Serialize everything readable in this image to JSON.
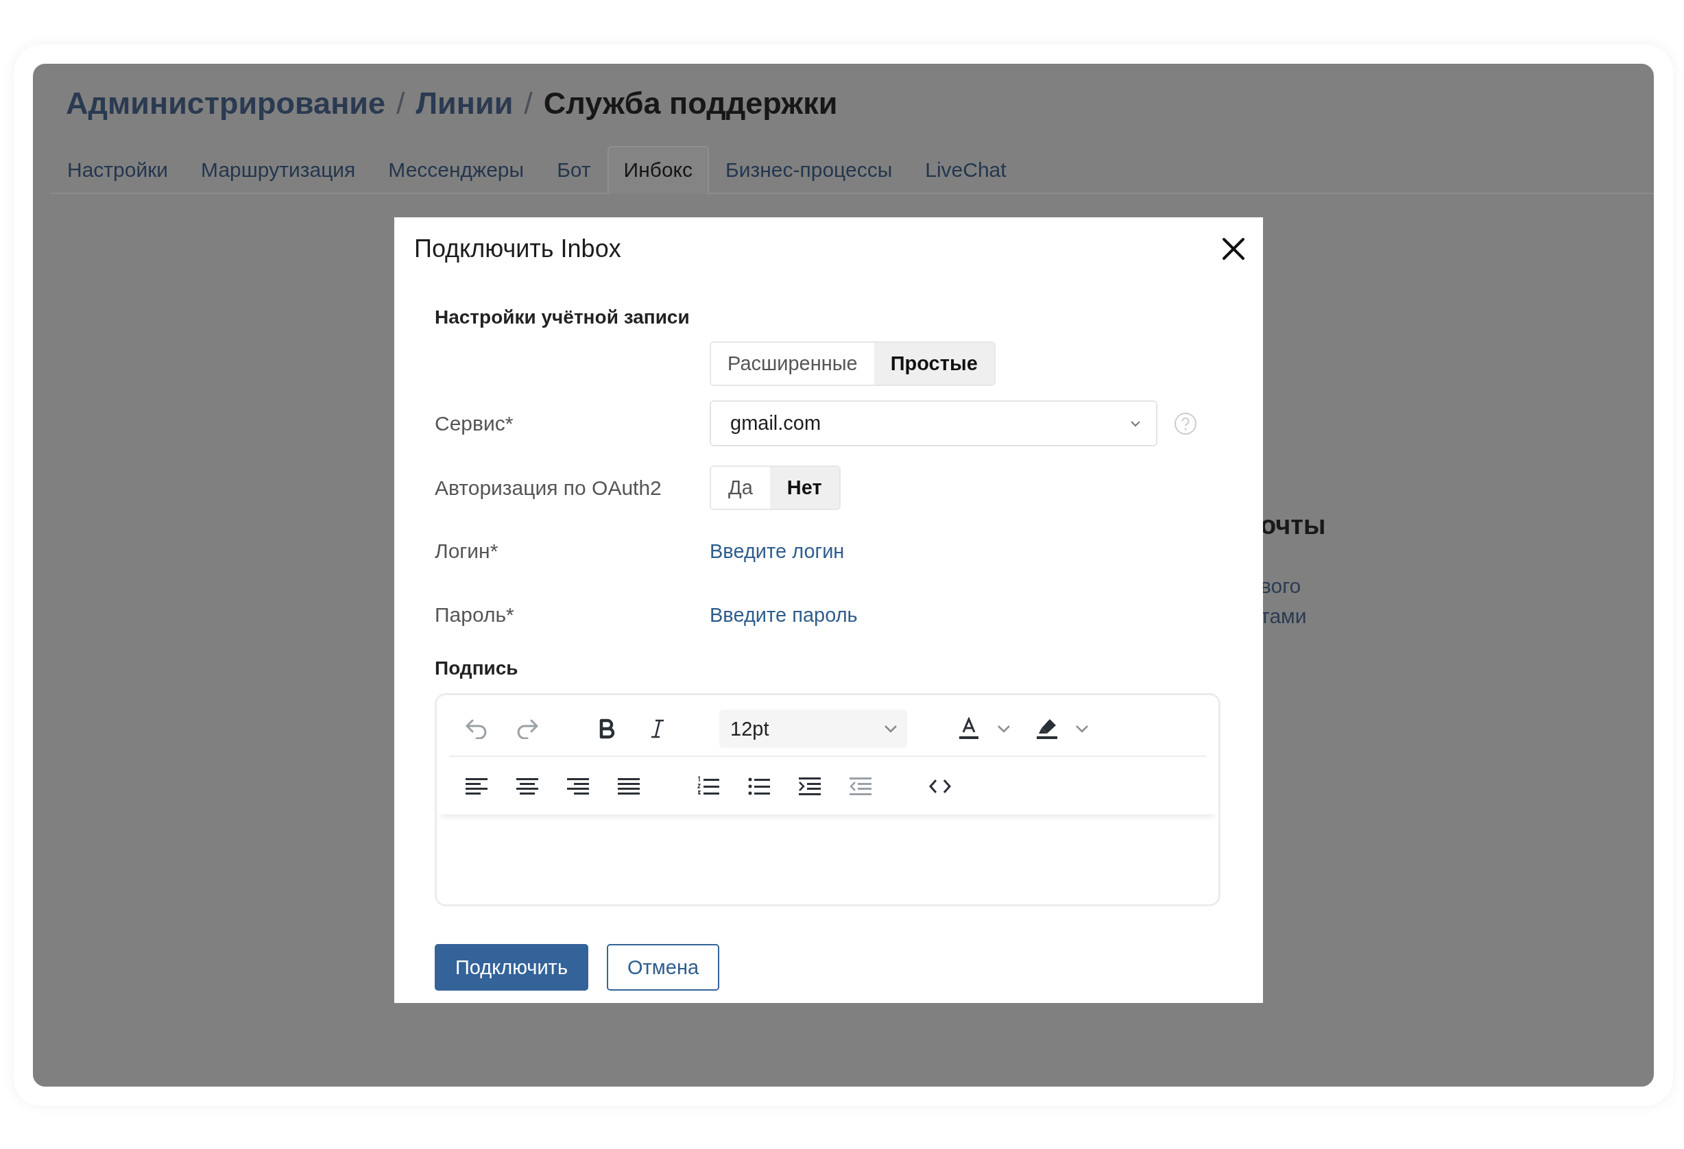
{
  "page": {
    "breadcrumbs": [
      {
        "label": "Администрирование",
        "current": false
      },
      {
        "label": "Линии",
        "separator_before": "/",
        "current": false
      },
      {
        "label": "Служба поддержки",
        "separator_before": "/",
        "current": true
      }
    ],
    "tabs": [
      {
        "label": "Настройки",
        "selected": false
      },
      {
        "label": "Маршрутизация",
        "selected": false
      },
      {
        "label": "Мессенджеры",
        "selected": false
      },
      {
        "label": "Бот",
        "selected": false
      },
      {
        "label": "Инбокс",
        "selected": true
      },
      {
        "label": "Бизнес-процессы",
        "selected": false
      },
      {
        "label": "LiveChat",
        "selected": false
      }
    ],
    "background_fragments": {
      "heading": "очты",
      "lines": [
        "вого",
        "тами"
      ]
    }
  },
  "dialog": {
    "title": "Подключить Inbox",
    "section_title": "Настройки учётной записи",
    "mode_toggle": [
      {
        "label": "Расширенные",
        "selected": false
      },
      {
        "label": "Простые",
        "selected": true
      }
    ],
    "fields": [
      {
        "kind": "select",
        "label": "Сервис*",
        "value": "gmail.com"
      },
      {
        "kind": "toggle",
        "label": "Авторизация по OAuth2",
        "options": [
          {
            "label": "Да",
            "selected": false
          },
          {
            "label": "Нет",
            "selected": true
          }
        ]
      },
      {
        "kind": "link",
        "label": "Логин*",
        "value": "Введите логин"
      },
      {
        "kind": "link",
        "label": "Пароль*",
        "value": "Введите пароль"
      }
    ],
    "signature": {
      "title": "Подпись",
      "toolbar_rows": [
        [
          [
            {
              "kind": "undo",
              "disabled": true
            },
            {
              "kind": "redo",
              "disabled": true
            }
          ],
          [
            {
              "kind": "bold",
              "disabled": false
            },
            {
              "kind": "italic",
              "disabled": false
            }
          ],
          [
            {
              "kind": "font-size",
              "value": "12pt",
              "disabled": false
            }
          ],
          [
            {
              "kind": "text-color",
              "disabled": false
            },
            {
              "kind": "caret",
              "disabled": false
            },
            {
              "kind": "highlight",
              "disabled": false
            },
            {
              "kind": "caret",
              "disabled": false
            }
          ]
        ],
        [
          [
            {
              "kind": "align-left",
              "disabled": false
            },
            {
              "kind": "align-center",
              "disabled": false
            },
            {
              "kind": "align-right",
              "disabled": false
            },
            {
              "kind": "justify",
              "disabled": false
            }
          ],
          [
            {
              "kind": "numbered-list",
              "disabled": false
            },
            {
              "kind": "bullet-list",
              "disabled": false
            },
            {
              "kind": "indent",
              "disabled": false
            },
            {
              "kind": "outdent",
              "disabled": true
            }
          ],
          [
            {
              "kind": "code",
              "disabled": false
            }
          ]
        ]
      ]
    },
    "buttons": [
      {
        "label": "Подключить",
        "kind": "primary"
      },
      {
        "label": "Отмена",
        "kind": "secondary"
      }
    ]
  }
}
